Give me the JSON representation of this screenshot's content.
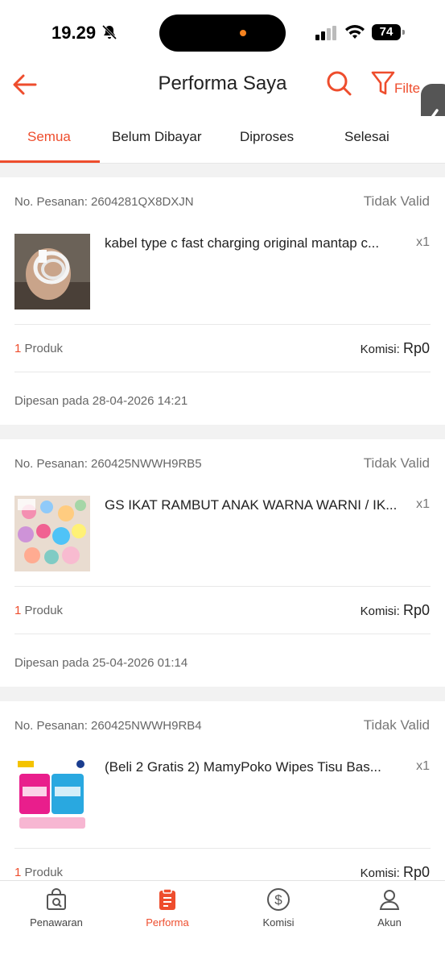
{
  "status_bar": {
    "time": "19.29",
    "battery": "74"
  },
  "header": {
    "title": "Performa Saya",
    "filter_label": "Filte"
  },
  "tabs": [
    {
      "label": "Semua",
      "active": true
    },
    {
      "label": "Belum Dibayar",
      "active": false
    },
    {
      "label": "Diproses",
      "active": false
    },
    {
      "label": "Selesai",
      "active": false
    }
  ],
  "labels": {
    "order_prefix": "No. Pesanan:",
    "product_word": "Produk",
    "komisi": "Komisi:",
    "ordered_prefix": "Dipesan pada"
  },
  "orders": [
    {
      "order_no": "No. Pesanan: 2604281QX8DXJN",
      "status": "Tidak Valid",
      "product_name": "kabel type c fast charging original mantap c...",
      "qty": "x1",
      "product_count": "1",
      "product_word": "Produk",
      "komisi_label": "Komisi:",
      "komisi_value": "Rp0",
      "date": "Dipesan pada 28-04-2026 14:21"
    },
    {
      "order_no": "No. Pesanan: 260425NWWH9RB5",
      "status": "Tidak Valid",
      "product_name": "GS IKAT RAMBUT ANAK WARNA WARNI / IK...",
      "qty": "x1",
      "product_count": "1",
      "product_word": "Produk",
      "komisi_label": "Komisi:",
      "komisi_value": "Rp0",
      "date": "Dipesan pada 25-04-2026 01:14"
    },
    {
      "order_no": "No. Pesanan: 260425NWWH9RB4",
      "status": "Tidak Valid",
      "product_name": "(Beli 2 Gratis 2) MamyPoko Wipes Tisu Bas...",
      "qty": "x1",
      "product_count": "1",
      "product_word": "Produk",
      "komisi_label": "Komisi:",
      "komisi_value": "Rp0",
      "date": ""
    }
  ],
  "bottom_nav": [
    {
      "label": "Penawaran",
      "icon": "offer-bag-icon",
      "active": false
    },
    {
      "label": "Performa",
      "icon": "clipboard-icon",
      "active": true
    },
    {
      "label": "Komisi",
      "icon": "dollar-circle-icon",
      "active": false
    },
    {
      "label": "Akun",
      "icon": "user-icon",
      "active": false
    }
  ],
  "colors": {
    "accent": "#ee4d2d",
    "background": "#f2f2f2"
  }
}
